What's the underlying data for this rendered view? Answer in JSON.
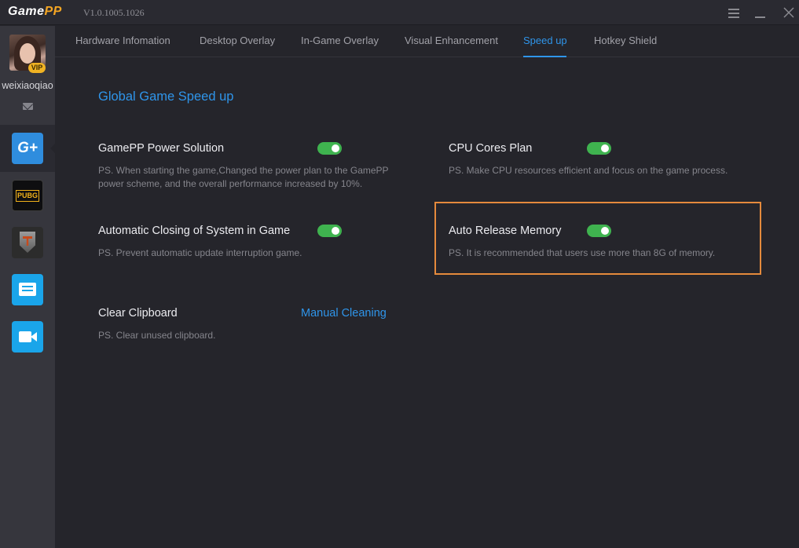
{
  "app": {
    "logo_game": "Game",
    "logo_pp": "PP",
    "version": "V1.0.1005.1026"
  },
  "window_controls": {
    "menu_icon": "hamburger-icon",
    "minimize_icon": "minimize-icon",
    "close_icon": "close-icon"
  },
  "user": {
    "name": "weixiaoqiao",
    "vip_badge": "VIP"
  },
  "sidebar": {
    "items": [
      {
        "name": "gameplus",
        "icon": "gameplus-icon",
        "label": "G+",
        "active": true
      },
      {
        "name": "pubg",
        "icon": "pubg-icon",
        "label": "PUBG"
      },
      {
        "name": "world-of-tanks",
        "icon": "world-of-tanks-icon"
      },
      {
        "name": "messages",
        "icon": "message-icon"
      },
      {
        "name": "video",
        "icon": "video-camera-icon"
      }
    ]
  },
  "tabs": [
    {
      "label": "Hardware Infomation"
    },
    {
      "label": "Desktop Overlay"
    },
    {
      "label": "In-Game Overlay"
    },
    {
      "label": "Visual Enhancement"
    },
    {
      "label": "Speed up",
      "active": true
    },
    {
      "label": "Hotkey Shield"
    }
  ],
  "main": {
    "section_title": "Global Game Speed up",
    "settings": [
      {
        "title": "GamePP Power Solution",
        "desc": "PS. When starting the game,Changed the power plan to the GamePP power scheme, and the overall performance increased by 10%.",
        "enabled": true
      },
      {
        "title": "CPU Cores Plan",
        "desc": "PS. Make CPU resources efficient and focus on the game process.",
        "enabled": true
      },
      {
        "title": "Automatic Closing of System in Game",
        "desc": "PS. Prevent automatic update interruption game.",
        "enabled": true
      },
      {
        "title": "Auto Release Memory",
        "desc": "PS. It is recommended that users use more than 8G of memory.",
        "enabled": true
      },
      {
        "title": "Clear Clipboard",
        "desc": "PS. Clear unused clipboard.",
        "action_label": "Manual Cleaning"
      }
    ]
  },
  "colors": {
    "accent": "#2f95ea",
    "toggle_on": "#3fb34f",
    "highlight": "#e58a3c",
    "logo_pp": "#f5a623"
  }
}
